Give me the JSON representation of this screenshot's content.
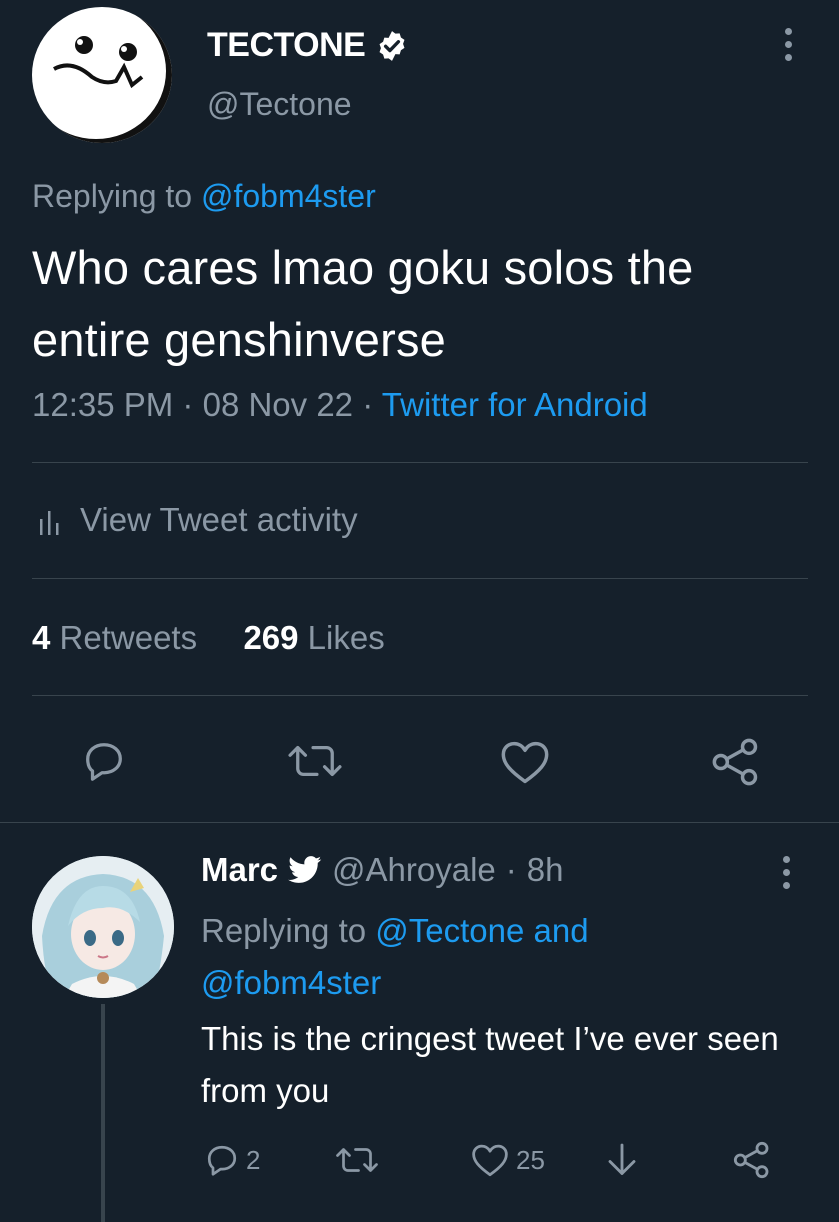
{
  "tweet": {
    "author_name": "TECTONE",
    "author_handle": "@Tectone",
    "replying_prefix": "Replying to",
    "replying_to": "@fobm4ster",
    "text": "Who cares lmao goku solos the entire genshinverse",
    "time": "12:35 PM",
    "sep1": "·",
    "date": "08 Nov 22",
    "sep2": "·",
    "source": "Twitter for Android",
    "activity_label": "View Tweet activity",
    "retweets_count": "4",
    "retweets_label": "Retweets",
    "likes_count": "269",
    "likes_label": "Likes"
  },
  "reply": {
    "author_name": "Marc",
    "author_handle": "@Ahroyale",
    "sep": "·",
    "age": "8h",
    "replying_prefix": "Replying to",
    "replying_to_line1": "@Tectone and",
    "replying_to_line2": "@fobm4ster",
    "text": "This is the cringest tweet I’ve ever seen from you",
    "reply_count": "2",
    "like_count": "25"
  },
  "colors": {
    "background": "#15202b",
    "link": "#1d9bf0",
    "muted": "#8b98a5",
    "divider": "#38444d"
  }
}
